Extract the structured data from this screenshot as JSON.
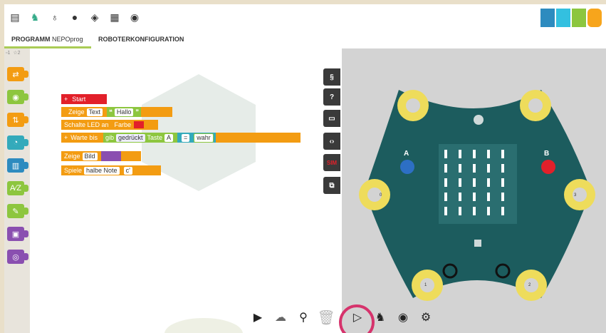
{
  "tabs": {
    "program_label": "PROGRAMM",
    "program_name": "NEPOprog",
    "robot_config": "ROBOTERKONFIGURATION"
  },
  "category_tabs": {
    "tab1": "1",
    "tab2": "2"
  },
  "side_buttons": {
    "code": "§",
    "help": "?",
    "sim": "SIM"
  },
  "blocks": {
    "start": "Start",
    "show_text_label": "Zeige",
    "show_text_type": "Text",
    "text_value": "Hallo",
    "led_label": "Schalte LED an",
    "led_color_label": "Farbe",
    "wait_label": "Warte bis",
    "get_label": "gib",
    "pressed_label": "gedrückt",
    "sensor_label": "Taste",
    "button_value": "A",
    "compare_op": "=",
    "bool_value": "wahr",
    "show_image_label": "Zeige",
    "show_image_type": "Bild",
    "play_label": "Spiele",
    "note_label": "halbe Note",
    "note_value": "c'"
  },
  "board": {
    "button_a": "A",
    "button_b": "B",
    "pin0": "0",
    "pin1": "1",
    "pin2": "2",
    "pin3": "3"
  },
  "colors": {
    "orange": "#f39c12",
    "green": "#8dc63f",
    "red": "#e2202a",
    "teal": "#33aabb",
    "purple": "#8a4fb0",
    "board": "#1c5c5e",
    "pin": "#eedc5b"
  }
}
